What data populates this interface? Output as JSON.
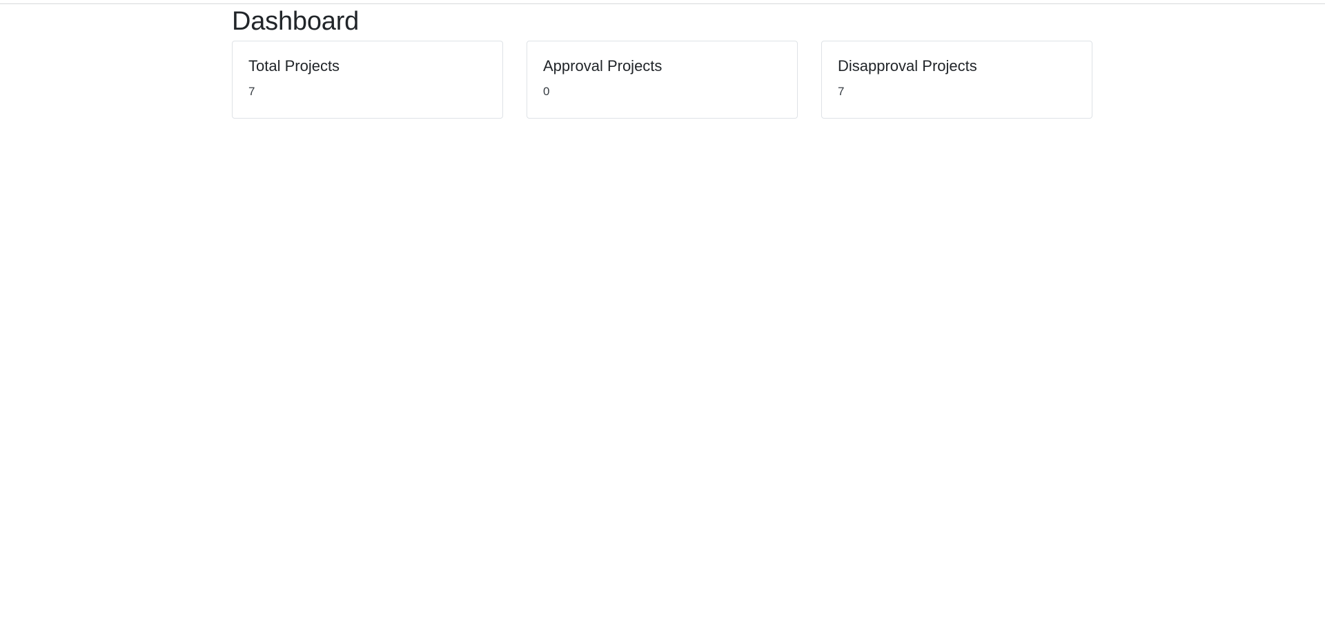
{
  "page": {
    "title": "Dashboard"
  },
  "cards": [
    {
      "title": "Total Projects",
      "value": "7"
    },
    {
      "title": "Approval Projects",
      "value": "0"
    },
    {
      "title": "Disapproval Projects",
      "value": "7"
    }
  ],
  "colors": {
    "text": "#212529",
    "border": "#dee2e6",
    "background": "#ffffff"
  }
}
